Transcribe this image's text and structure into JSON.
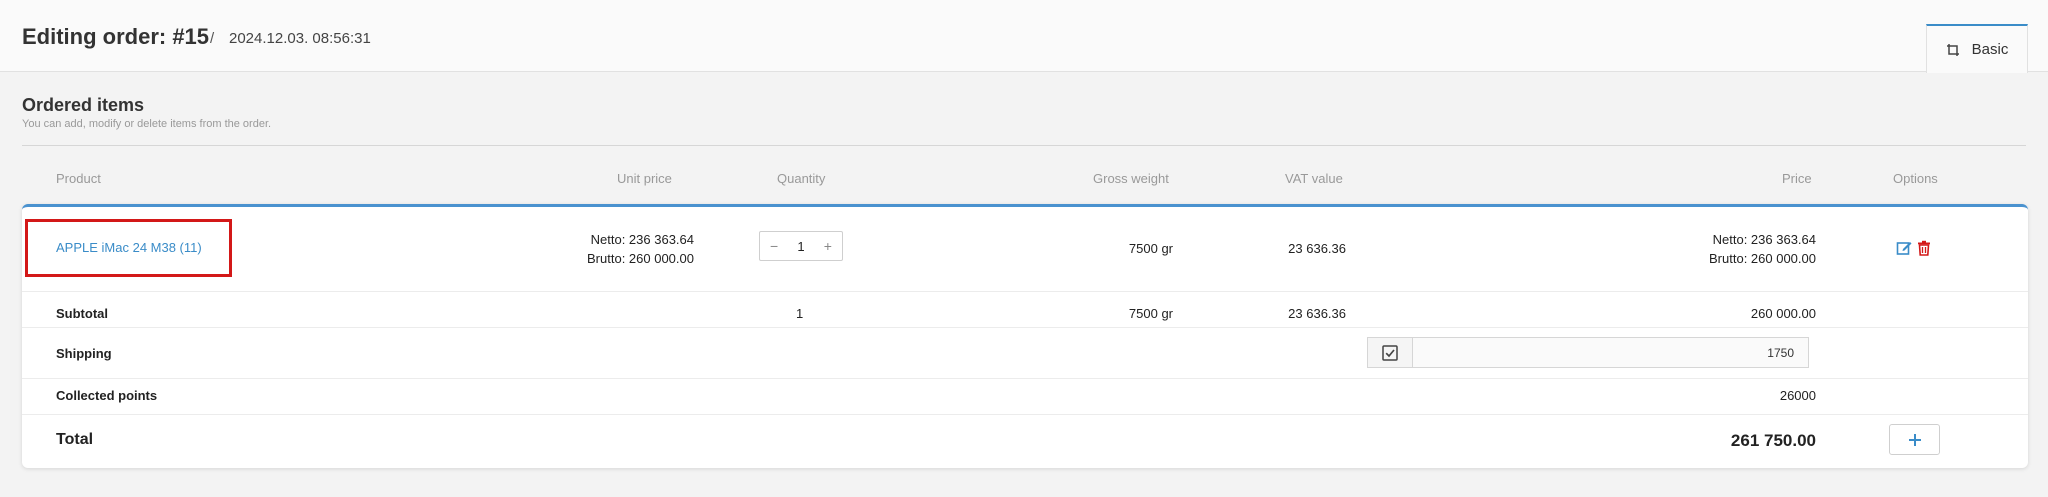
{
  "header": {
    "title": "Editing order: #15",
    "separator": "/",
    "date": "2024.12.03. 08:56:31",
    "tab_label": "Basic"
  },
  "section": {
    "title": "Ordered items",
    "subtitle": "You can add, modify or delete items from the order."
  },
  "columns": {
    "product": "Product",
    "unit_price": "Unit price",
    "quantity": "Quantity",
    "gross_weight": "Gross weight",
    "vat_value": "VAT value",
    "price": "Price",
    "options": "Options"
  },
  "item": {
    "name": "APPLE iMac 24 M38 (11)",
    "unit_netto": "Netto: 236 363.64",
    "unit_brutto": "Brutto: 260 000.00",
    "quantity": "1",
    "qty_minus": "−",
    "qty_plus": "+",
    "gross_weight": "7500 gr",
    "vat_value": "23 636.36",
    "price_netto": "Netto: 236 363.64",
    "price_brutto": "Brutto: 260 000.00"
  },
  "subtotal": {
    "label": "Subtotal",
    "quantity": "1",
    "gross_weight": "7500 gr",
    "vat_value": "23 636.36",
    "price": "260 000.00"
  },
  "shipping": {
    "label": "Shipping",
    "value": "1750"
  },
  "points": {
    "label": "Collected points",
    "value": "26000"
  },
  "total": {
    "label": "Total",
    "value": "261 750.00"
  },
  "colors": {
    "accent": "#3a8cc8",
    "danger": "#d31818",
    "highlight": "#d31818"
  }
}
